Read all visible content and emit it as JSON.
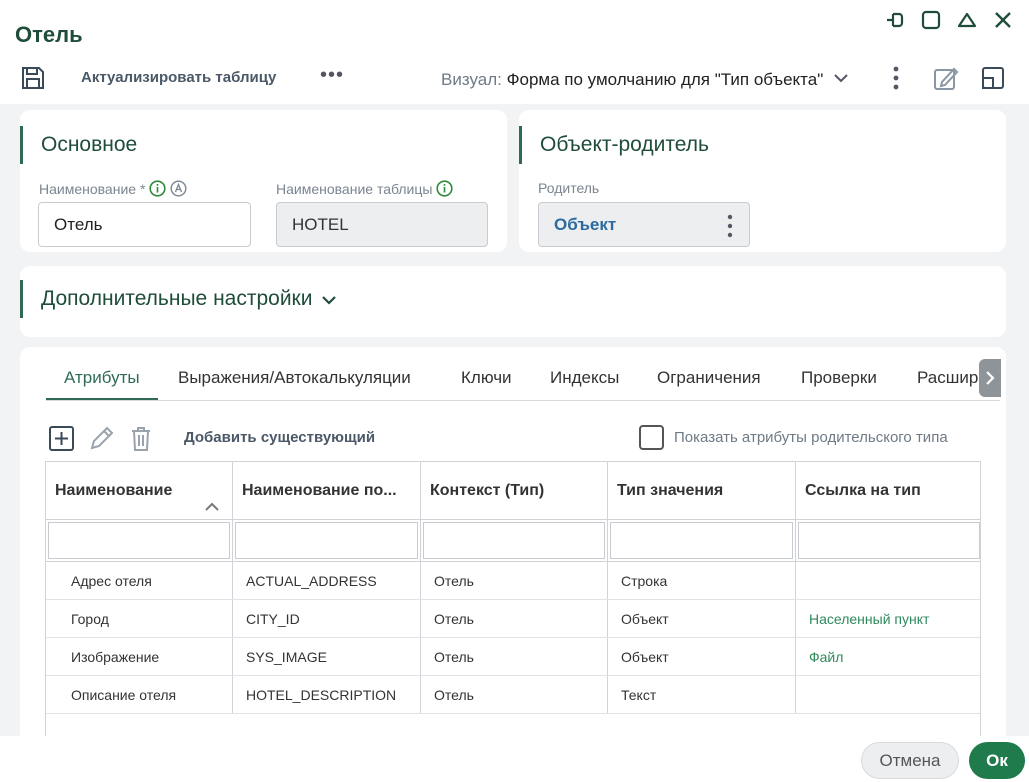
{
  "window": {
    "title": "Отель"
  },
  "toolbar": {
    "refresh_label": "Актуализировать таблицу",
    "more_label": "•••",
    "visual_label": "Визуал:",
    "visual_value": "Форма по умолчанию для \"Тип объекта\""
  },
  "main_section": {
    "title": "Основное",
    "name_label": "Наименование *",
    "name_value": "Отель",
    "table_name_label": "Наименование таблицы",
    "table_name_value": "HOTEL"
  },
  "parent_section": {
    "title": "Объект-родитель",
    "parent_label": "Родитель",
    "parent_value": "Объект"
  },
  "extra_section": {
    "title": "Дополнительные настройки"
  },
  "tabs": [
    {
      "label": "Атрибуты",
      "active": true
    },
    {
      "label": "Выражения/Автокалькуляции",
      "active": false
    },
    {
      "label": "Ключи",
      "active": false
    },
    {
      "label": "Индексы",
      "active": false
    },
    {
      "label": "Ограничения",
      "active": false
    },
    {
      "label": "Проверки",
      "active": false
    },
    {
      "label": "Расширения",
      "active": false
    }
  ],
  "grid_toolbar": {
    "add_existing_label": "Добавить существующий",
    "show_parent_attrs_label": "Показать атрибуты родительского типа",
    "show_parent_attrs_checked": false
  },
  "table": {
    "columns": [
      "Наименование",
      "Наименование по...",
      "Контекст (Тип)",
      "Тип значения",
      "Ссылка на тип"
    ],
    "rows": [
      [
        "Адрес отеля",
        "ACTUAL_ADDRESS",
        "Отель",
        "Строка",
        ""
      ],
      [
        "Город",
        "CITY_ID",
        "Отель",
        "Объект",
        "Населенный пункт"
      ],
      [
        "Изображение",
        "SYS_IMAGE",
        "Отель",
        "Объект",
        "Файл"
      ],
      [
        "Описание отеля",
        "HOTEL_DESCRIPTION",
        "Отель",
        "Текст",
        ""
      ]
    ]
  },
  "footer": {
    "cancel_label": "Отмена",
    "ok_label": "Ок"
  },
  "colors": {
    "accent": "#2f6b54",
    "primary_button": "#1f7a4c",
    "link_blue": "#2c6aa0",
    "link_green": "#2e8a5c"
  }
}
